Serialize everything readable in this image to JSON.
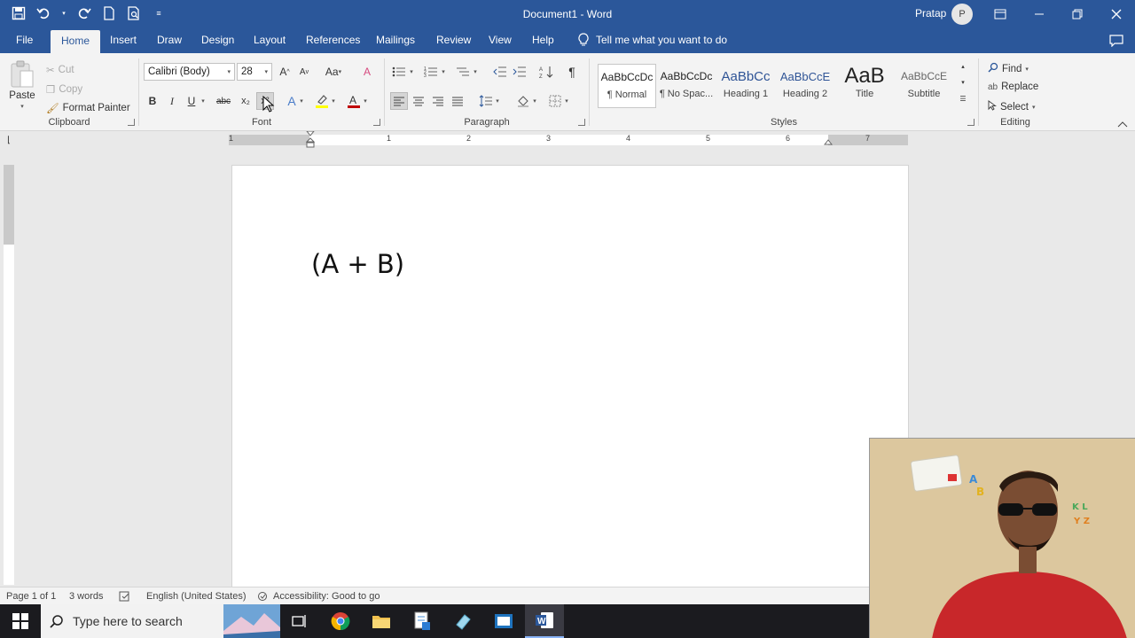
{
  "window": {
    "title": "Document1 - Word",
    "user_name": "Pratap",
    "user_initial": "P"
  },
  "tabs": {
    "file": "File",
    "home": "Home",
    "insert": "Insert",
    "draw": "Draw",
    "design": "Design",
    "layout": "Layout",
    "references": "References",
    "mailings": "Mailings",
    "review": "Review",
    "view": "View",
    "help": "Help",
    "tell_me": "Tell me what you want to do"
  },
  "clipboard": {
    "label": "Clipboard",
    "paste": "Paste",
    "cut": "Cut",
    "copy": "Copy",
    "format_painter": "Format Painter"
  },
  "font": {
    "label": "Font",
    "family": "Calibri (Body)",
    "size": "28",
    "change_case": "Aa",
    "bold": "B",
    "italic": "I",
    "underline": "U",
    "strikethrough": "abc",
    "subscript": "x₂",
    "superscript": "x²"
  },
  "paragraph": {
    "label": "Paragraph",
    "show_marks": "¶"
  },
  "styles": {
    "label": "Styles",
    "items": [
      {
        "sample": "AaBbCcDc",
        "name": "¶ Normal"
      },
      {
        "sample": "AaBbCcDc",
        "name": "¶ No Spac..."
      },
      {
        "sample": "AaBbCc",
        "name": "Heading 1"
      },
      {
        "sample": "AaBbCcE",
        "name": "Heading 2"
      },
      {
        "sample": "AaB",
        "name": "Title"
      },
      {
        "sample": "AaBbCcE",
        "name": "Subtitle"
      }
    ]
  },
  "editing": {
    "label": "Editing",
    "find": "Find",
    "replace": "Replace",
    "select": "Select"
  },
  "ruler": {
    "numbers": [
      "1",
      "1",
      "2",
      "3",
      "4",
      "5",
      "6",
      "7"
    ]
  },
  "document": {
    "text": "(A + B)"
  },
  "status": {
    "page": "Page 1 of 1",
    "words": "3 words",
    "language": "English (United States)",
    "accessibility": "Accessibility: Good to go"
  },
  "taskbar": {
    "search_placeholder": "Type here to search"
  },
  "colors": {
    "word_blue": "#2b579a",
    "ribbon_bg": "#f3f3f3",
    "highlight_yellow": "#ffff00",
    "font_color_red": "#c00000"
  }
}
